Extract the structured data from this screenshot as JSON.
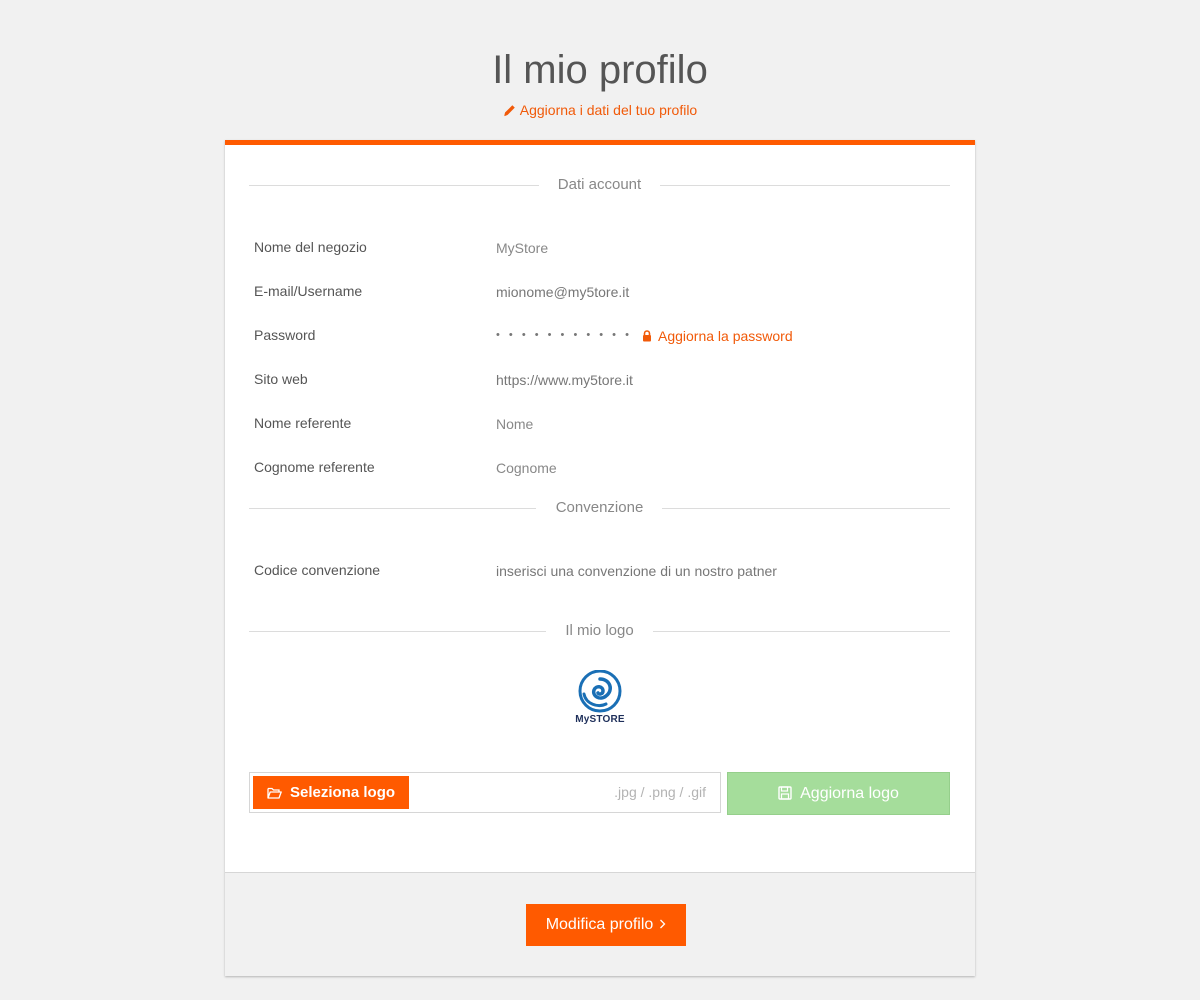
{
  "header": {
    "title": "Il mio profilo",
    "subtitle_link": "Aggiorna i dati del tuo profilo"
  },
  "sections": {
    "account": {
      "title": "Dati account",
      "rows": [
        {
          "label": "Nome del negozio",
          "value": "MyStore"
        },
        {
          "label": "E-mail/Username",
          "value": "mionome@my5tore.it"
        },
        {
          "label": "Password",
          "value": "• • • • • • • • • • •",
          "action_label": "Aggiorna la password"
        },
        {
          "label": "Sito web",
          "value": "https://www.my5tore.it"
        },
        {
          "label": "Nome referente",
          "placeholder": "Nome"
        },
        {
          "label": "Cognome referente",
          "placeholder": "Cognome"
        }
      ]
    },
    "agreement": {
      "title": "Convenzione",
      "label": "Codice convenzione",
      "placeholder": "inserisci una convenzione di un nostro patner"
    },
    "logo": {
      "title": "Il mio logo",
      "logo_text": "MySTORE",
      "select_label": "Seleziona logo",
      "file_types": ".jpg / .png / .gif",
      "update_label": "Aggiorna logo"
    }
  },
  "footer": {
    "submit_label": "Modifica profilo"
  },
  "colors": {
    "accent": "#ff5a00",
    "success_disabled": "#a5dd9b",
    "background": "#f1f1f1",
    "logo_blue": "#1a6fb5",
    "logo_text": "#1e2f5a"
  },
  "icons": {
    "subtitle": "pencil-icon",
    "password_action": "lock-icon",
    "select_logo": "folder-open-icon",
    "update_logo": "save-icon",
    "submit": "chevron-right-icon"
  }
}
